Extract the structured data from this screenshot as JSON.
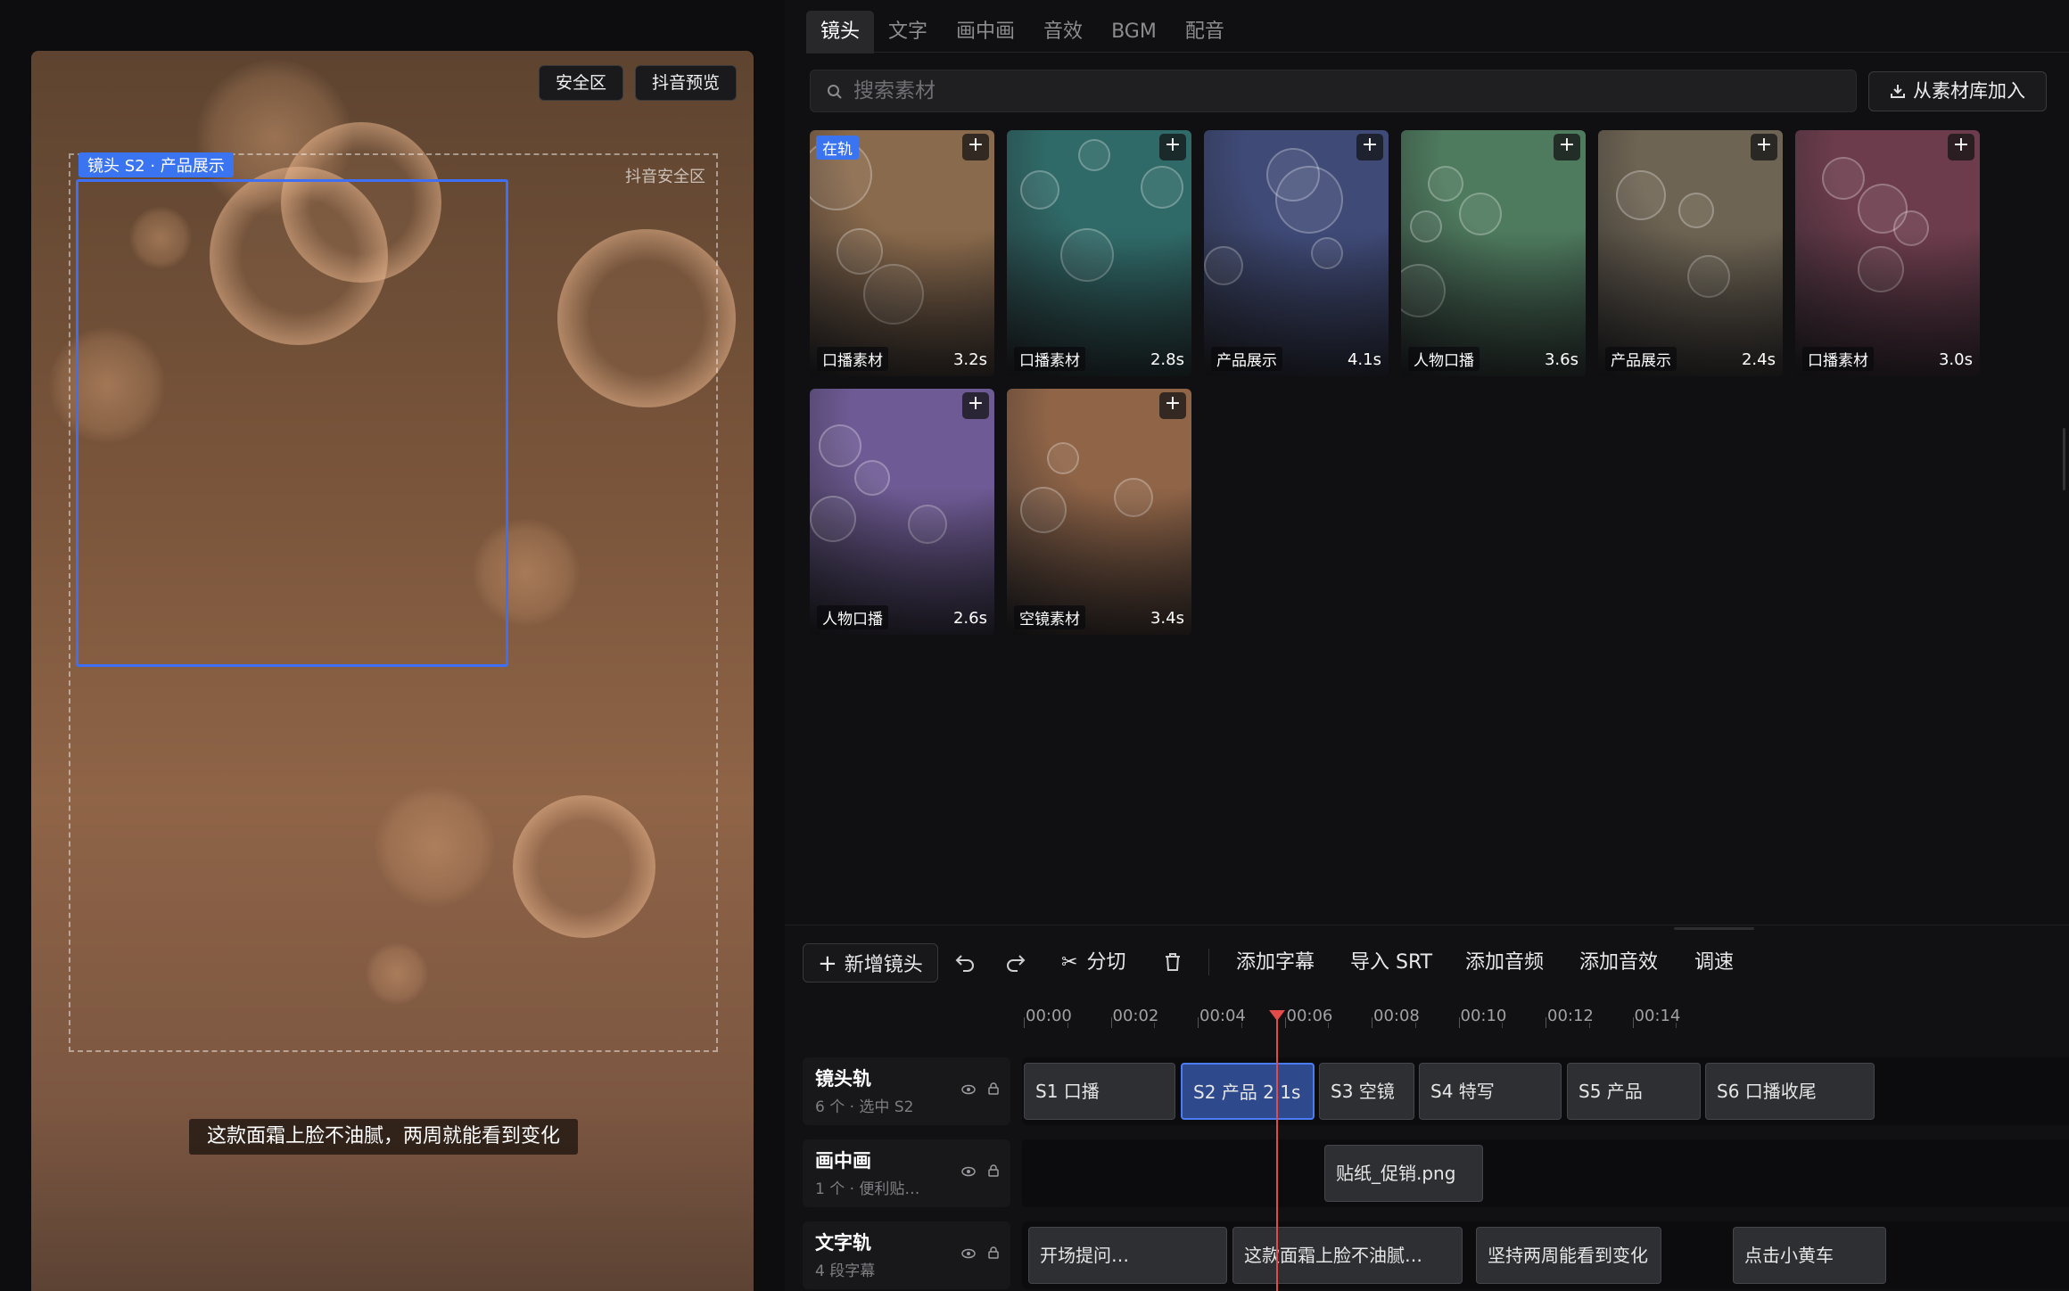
{
  "preview": {
    "safe_zone_button": "安全区",
    "douyin_preview_button": "抖音预览",
    "safe_zone_label": "抖音安全区",
    "shot_tag": "镜头 S2 · 产品展示",
    "subtitle": "这款面霜上脸不油腻，两周就能看到变化"
  },
  "library": {
    "tabs": [
      {
        "label": "镜头",
        "active": true
      },
      {
        "label": "文字"
      },
      {
        "label": "画中画"
      },
      {
        "label": "音效"
      },
      {
        "label": "BGM"
      },
      {
        "label": "配音"
      }
    ],
    "search": {
      "placeholder": "搜索素材",
      "value": ""
    },
    "import_button": "从素材库加入",
    "on_track_badge": "在轨",
    "add_symbol": "+",
    "cards": [
      {
        "name": "口播素材",
        "duration": "3.2s",
        "on_track": true,
        "color": "#8a6a4c"
      },
      {
        "name": "口播素材",
        "duration": "2.8s",
        "color": "#2f6a68"
      },
      {
        "name": "产品展示",
        "duration": "4.1s",
        "color": "#3f4a77"
      },
      {
        "name": "人物口播",
        "duration": "3.6s",
        "color": "#4e7a5e"
      },
      {
        "name": "产品展示",
        "duration": "2.4s",
        "color": "#6e6453"
      },
      {
        "name": "口播素材",
        "duration": "3.0s",
        "color": "#6c3c4c"
      },
      {
        "name": "人物口播",
        "duration": "2.6s",
        "color": "#6e5a94"
      },
      {
        "name": "空镜素材",
        "duration": "3.4s",
        "color": "#8f6447"
      }
    ]
  },
  "timeline": {
    "toolbar": {
      "new_shot": "新增镜头",
      "split": "分切",
      "add_subtitle": "添加字幕",
      "import_srt": "导入 SRT",
      "add_audio": "添加音频",
      "add_sfx": "添加音效",
      "speed": "调速"
    },
    "ruler": [
      "00:00",
      "00:02",
      "00:04",
      "00:06",
      "00:08",
      "00:10",
      "00:12",
      "00:14"
    ],
    "tracks": [
      {
        "name": "镜头轨",
        "sub": "6 个 · 选中 S2",
        "clips": [
          "S1 口播",
          "S2 产品 2.1s",
          "S3 空镜",
          "S4 特写",
          "S5 产品",
          "S6 口播收尾"
        ]
      },
      {
        "name": "画中画",
        "sub": "1 个 · 便利贴…",
        "clips": [
          "贴纸_促销.png"
        ]
      },
      {
        "name": "文字轨",
        "sub": "4 段字幕",
        "clips": [
          "开场提问…",
          "这款面霜上脸不油腻…",
          "坚持两周能看到变化",
          "点击小黄车"
        ]
      }
    ]
  }
}
